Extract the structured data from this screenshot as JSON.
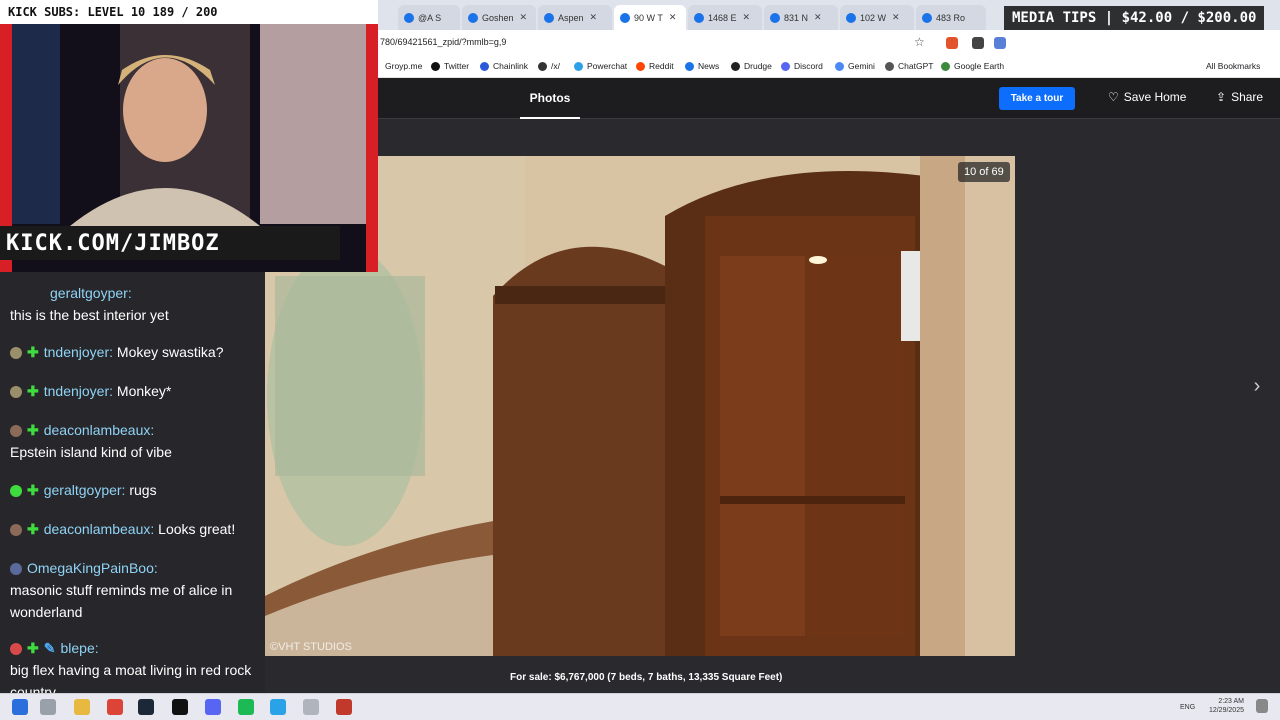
{
  "browser": {
    "tabs": [
      {
        "label": "@A S"
      },
      {
        "label": "Goshen"
      },
      {
        "label": "Aspen"
      },
      {
        "label": "90 W T"
      },
      {
        "label": "1468 E"
      },
      {
        "label": "831 N"
      },
      {
        "label": "102 W"
      },
      {
        "label": "483 Ro"
      }
    ],
    "url": "780/69421561_zpid/?mmlb=g,9",
    "bookmarks": [
      "Groyp.me",
      "Twitter",
      "Chainlink",
      "/x/",
      "Powerchat",
      "Reddit",
      "News",
      "Drudge",
      "Discord",
      "Gemini",
      "ChatGPT",
      "Google Earth"
    ],
    "all_bookmarks": "All Bookmarks"
  },
  "listing": {
    "tab_photos": "Photos",
    "take_tour": "Take a tour",
    "save_home": "Save Home",
    "share": "Share",
    "photo_counter": "10 of 69",
    "watermark": "©VHT STUDIOS",
    "caption": "For sale: $6,767,000 (7 beds, 7 baths, 13,335 Square Feet)"
  },
  "stream": {
    "kick_subs": "KICK SUBS: LEVEL 10 189 / 200",
    "media_tips": "MEDIA TIPS | $42.00 / $200.00",
    "kick_url": "KICK.COM/JIMBOZ"
  },
  "chat": {
    "messages": [
      {
        "user": "geraltgoyper:",
        "text": "this is the best interior yet"
      },
      {
        "user": "tndenjoyer:",
        "text": "Mokey swastika?"
      },
      {
        "user": "tndenjoyer:",
        "text": "Monkey*"
      },
      {
        "user": "deaconlambeaux:",
        "text": "Epstein island kind of vibe"
      },
      {
        "user": "geraltgoyper:",
        "text": "rugs"
      },
      {
        "user": "deaconlambeaux:",
        "text": "Looks great!"
      },
      {
        "user": "OmegaKingPainBoo:",
        "text": "masonic stuff reminds me of alice in wonderland"
      },
      {
        "user": "blepe:",
        "text": "big flex having a moat living in red rock country"
      }
    ]
  },
  "taskbar": {
    "lang": "ENG",
    "time": "2:23 AM",
    "date": "12/29/2025"
  },
  "colors": {
    "accent_blue": "#0d6efd",
    "chat_username": "#8fd3f5",
    "chat_plus": "#3fdc3f"
  }
}
